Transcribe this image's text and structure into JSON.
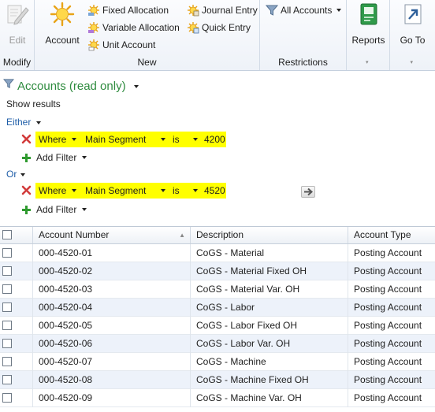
{
  "ribbon": {
    "modify": {
      "group_label": "Modify",
      "edit_label": "Edit"
    },
    "new": {
      "group_label": "New",
      "account_label": "Account",
      "fixed_allocation_label": "Fixed Allocation",
      "variable_allocation_label": "Variable Allocation",
      "unit_account_label": "Unit Account",
      "journal_entry_label": "Journal Entry",
      "quick_entry_label": "Quick Entry"
    },
    "restrictions": {
      "group_label": "Restrictions",
      "all_accounts_label": "All Accounts"
    },
    "reports": {
      "label": "Reports"
    },
    "goto": {
      "label": "Go To"
    }
  },
  "filter": {
    "title": "Accounts (read only)",
    "show_results": "Show results",
    "either_label": "Either",
    "or_label": "Or",
    "add_filter_label": "Add Filter",
    "criteria": [
      {
        "where": "Where",
        "field": "Main Segment",
        "op": "is",
        "value": "4200"
      },
      {
        "where": "Where",
        "field": "Main Segment",
        "op": "is",
        "value": "4520"
      }
    ]
  },
  "grid": {
    "columns": [
      "Account Number",
      "Description",
      "Account Type"
    ],
    "rows": [
      {
        "number": "000-4520-01",
        "description": "CoGS - Material",
        "type": "Posting Account"
      },
      {
        "number": "000-4520-02",
        "description": "CoGS - Material Fixed OH",
        "type": "Posting Account"
      },
      {
        "number": "000-4520-03",
        "description": "CoGS - Material Var. OH",
        "type": "Posting Account"
      },
      {
        "number": "000-4520-04",
        "description": "CoGS - Labor",
        "type": "Posting Account"
      },
      {
        "number": "000-4520-05",
        "description": "CoGS - Labor Fixed OH",
        "type": "Posting Account"
      },
      {
        "number": "000-4520-06",
        "description": "CoGS - Labor Var. OH",
        "type": "Posting Account"
      },
      {
        "number": "000-4520-07",
        "description": "CoGS - Machine",
        "type": "Posting Account"
      },
      {
        "number": "000-4520-08",
        "description": "CoGS - Machine Fixed OH",
        "type": "Posting Account"
      },
      {
        "number": "000-4520-09",
        "description": "CoGS - Machine Var. OH",
        "type": "Posting Account"
      }
    ]
  },
  "colors": {
    "filter_title": "#2e8b3e",
    "logic_link": "#1f5ea8",
    "criteria_highlight": "#ffff00",
    "alt_row": "#edf2fa"
  },
  "icons": {
    "edit": "pencil-icon",
    "account": "sun-icon",
    "allocation": "sun-small-icon",
    "filter": "funnel-icon",
    "reports": "green-report-icon",
    "goto": "goto-arrow-icon",
    "remove": "red-x-icon",
    "add": "green-plus-icon"
  }
}
